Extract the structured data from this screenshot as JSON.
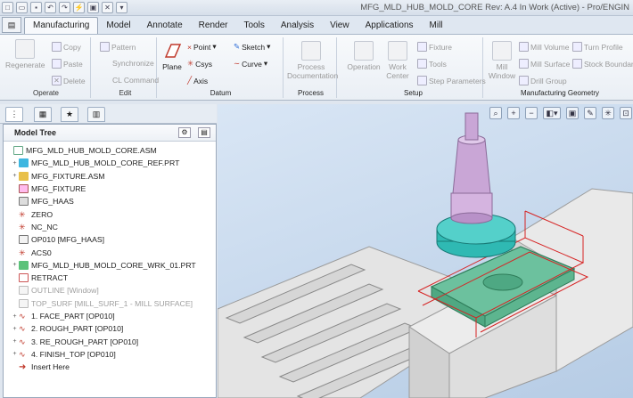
{
  "window": {
    "title": "MFG_MLD_HUB_MOLD_CORE Rev: A.4 In Work (Active) - Pro/ENGIN"
  },
  "tabs": [
    "Manufacturing",
    "Model",
    "Annotate",
    "Render",
    "Tools",
    "Analysis",
    "View",
    "Applications",
    "Mill"
  ],
  "active_tab": "Manufacturing",
  "ribbon": {
    "operate": {
      "label": "Operate",
      "regenerate": "Regenerate",
      "copy": "Copy",
      "paste": "Paste",
      "delete": "Delete"
    },
    "edit": {
      "label": "Edit",
      "pattern": "Pattern",
      "synchronize": "Synchronize",
      "cl_command": "CL Command"
    },
    "datum": {
      "label": "Datum",
      "plane": "Plane",
      "point": "Point",
      "csys": "Csys",
      "axis": "Axis",
      "sketch": "Sketch",
      "curve": "Curve"
    },
    "process": {
      "label": "Process",
      "documentation": "Process Documentation"
    },
    "setup": {
      "label": "Setup",
      "operation": "Operation",
      "work_center": "Work Center",
      "fixture": "Fixture",
      "tools": "Tools",
      "step_parameters": "Step Parameters"
    },
    "mfg_geometry": {
      "label": "Manufacturing Geometry",
      "mill_window": "Mill Window",
      "mill_volume": "Mill Volume",
      "mill_surface": "Mill Surface",
      "drill_group": "Drill Group",
      "turn_profile": "Turn Profile",
      "stock_boundary": "Stock Boundary"
    }
  },
  "model_tree": {
    "title": "Model Tree",
    "items": [
      {
        "label": "MFG_MLD_HUB_MOLD_CORE.ASM"
      },
      {
        "label": "MFG_MLD_HUB_MOLD_CORE_REF.PRT"
      },
      {
        "label": "MFG_FIXTURE.ASM"
      },
      {
        "label": "MFG_FIXTURE"
      },
      {
        "label": "MFG_HAAS"
      },
      {
        "label": "ZERO"
      },
      {
        "label": "NC_NC"
      },
      {
        "label": "OP010 [MFG_HAAS]"
      },
      {
        "label": "ACS0"
      },
      {
        "label": "MFG_MLD_HUB_MOLD_CORE_WRK_01.PRT"
      },
      {
        "label": "RETRACT"
      },
      {
        "label": "OUTLINE [Window]"
      },
      {
        "label": "TOP_SURF [MILL_SURF_1 - MILL SURFACE]"
      },
      {
        "label": "1. FACE_PART [OP010]"
      },
      {
        "label": "2. ROUGH_PART [OP010]"
      },
      {
        "label": "3. RE_ROUGH_PART [OP010]"
      },
      {
        "label": "4. FINISH_TOP [OP010]"
      },
      {
        "label": "Insert Here"
      }
    ]
  },
  "colors": {
    "accent": "#2a6ad6",
    "tool_body": "#c9a6d6",
    "holder": "#2ab5b0",
    "workpiece": "#6cc19e",
    "path": "#d62222",
    "machine": "#e1e1e1"
  }
}
